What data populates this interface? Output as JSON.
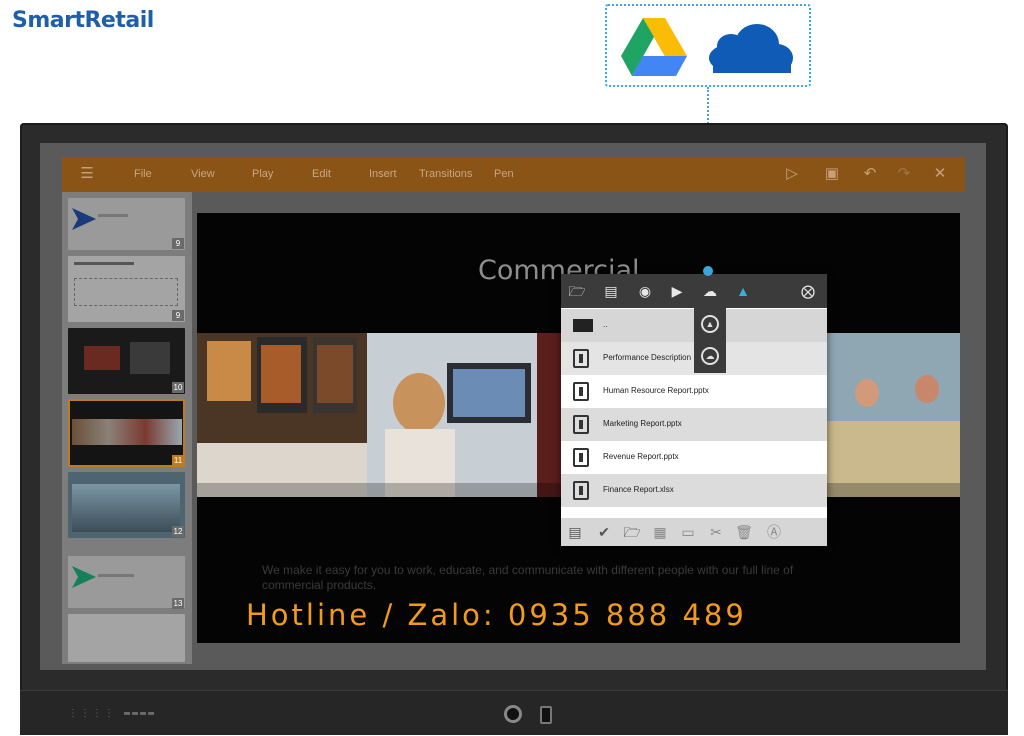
{
  "brand": {
    "name": "SmartRetail"
  },
  "cloud_services": [
    {
      "name": "Google Drive",
      "icon": "google-drive-icon"
    },
    {
      "name": "OneDrive",
      "icon": "onedrive-icon"
    }
  ],
  "app": {
    "menu": [
      "File",
      "View",
      "Play",
      "Edit",
      "Insert",
      "Transitions",
      "Pen"
    ],
    "menu_icons": [
      "play-icon",
      "save-icon",
      "undo-icon",
      "redo-icon",
      "close-icon"
    ]
  },
  "slides": [
    {
      "number": "9"
    },
    {
      "number": "9"
    },
    {
      "number": "10"
    },
    {
      "number": "11"
    },
    {
      "number": "12"
    },
    {
      "number": "13"
    }
  ],
  "slide": {
    "title": "Commercial",
    "body": "We make it easy for you to work, educate, and communicate with different people with our full line of commercial products."
  },
  "file_manager": {
    "parent_label": "..",
    "files": [
      "Performance Description",
      "Human Resource Report.pptx",
      "Marketing Report.pptx",
      "Revenue Report.pptx",
      "Finance Report.xlsx"
    ],
    "toolbar_icons": [
      "folder-icon",
      "document-icon",
      "image-icon",
      "video-icon",
      "cloud-upload-icon",
      "network-drive-icon",
      "close-circle-icon"
    ],
    "footer_icons": [
      "import-icon",
      "select-icon",
      "new-folder-icon",
      "copy-icon",
      "paste-icon",
      "cut-icon",
      "delete-icon",
      "rename-icon"
    ]
  },
  "hotline": "Hotline / Zalo: 0935 888 489",
  "colors": {
    "brand": "#1f5fa8",
    "menubar": "#8a5416",
    "hotline": "#f39a1c",
    "accent_line": "#3aa7d9"
  }
}
